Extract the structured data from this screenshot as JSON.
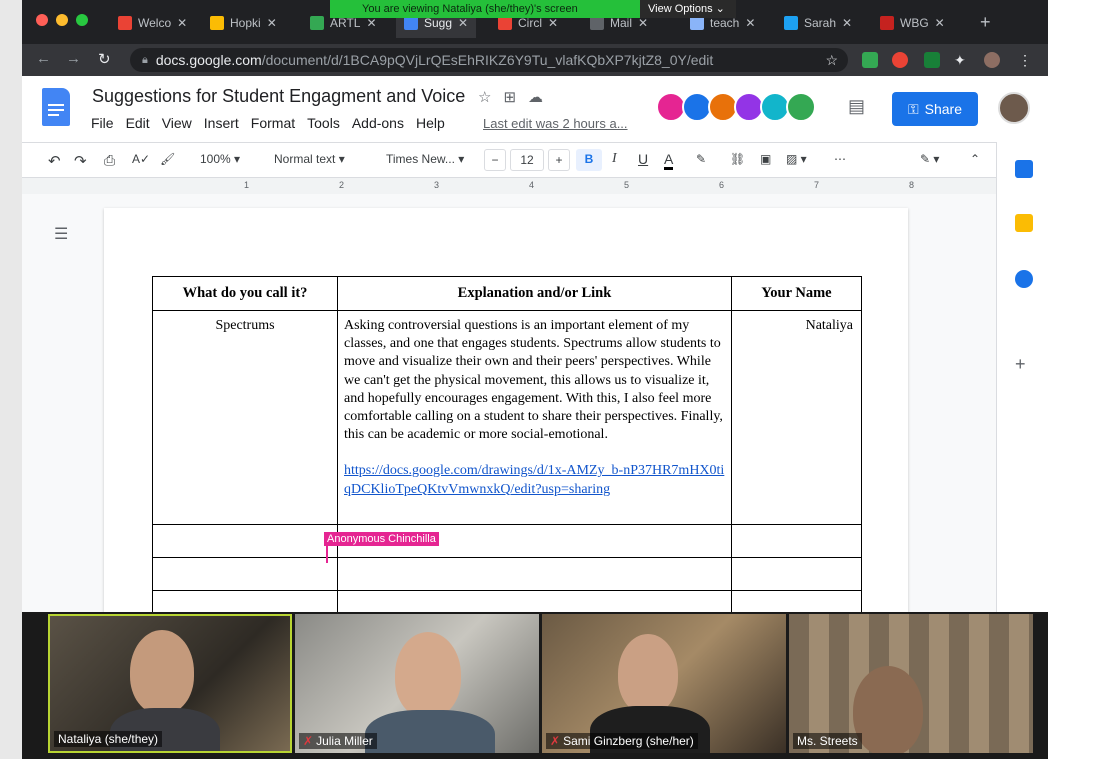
{
  "zoom": {
    "banner": "You are viewing Nataliya (she/they)'s screen",
    "view_options": "View Options ⌄"
  },
  "browser": {
    "tabs": [
      {
        "label": "Welco",
        "color": "#ea4335"
      },
      {
        "label": "Hopki",
        "color": "#fbbc04"
      },
      {
        "label": "ARTL",
        "color": "#34a853"
      },
      {
        "label": "Sugg",
        "color": "#4285f4"
      },
      {
        "label": "Circl",
        "color": "#ea4335"
      },
      {
        "label": "Mail",
        "color": "#5f6368"
      },
      {
        "label": "teach",
        "color": "#8ab4f8"
      },
      {
        "label": "Sarah",
        "color": "#1da1f2"
      },
      {
        "label": "WBG",
        "color": "#c5221f"
      }
    ],
    "url_host": "docs.google.com",
    "url_path": "/document/d/1BCA9pQVjLrQEsEhRIKZ6Y9Tu_vlafKQbXP7kjtZ8_0Y/edit"
  },
  "docs": {
    "title": "Suggestions for Student Engagment and Voice",
    "menu": [
      "File",
      "Edit",
      "View",
      "Insert",
      "Format",
      "Tools",
      "Add-ons",
      "Help"
    ],
    "last_edit": "Last edit was 2 hours a...",
    "share": "Share",
    "toolbar": {
      "zoom": "100%",
      "style": "Normal text",
      "font": "Times New...",
      "size": "12",
      "minus": "−",
      "plus": "+"
    },
    "ruler": [
      "1",
      "2",
      "3",
      "4",
      "5",
      "6",
      "7",
      "8"
    ],
    "collaborator_colors": [
      "#e52592",
      "#1a73e8",
      "#e8710a",
      "#9334e6",
      "#12b5cb",
      "#34a853"
    ]
  },
  "table": {
    "headers": [
      "What do you call it?",
      "Explanation and/or Link",
      "Your Name"
    ],
    "row1": {
      "name": "Spectrums",
      "explanation": "Asking controversial questions is an important element of my classes, and one that engages students. Spectrums allow students to move and visualize their own and their peers' perspectives. While we can't get the physical movement, this allows us to visualize it, and hopefully encourages engagement. With this, I also feel more comfortable calling on a student to share their perspectives. Finally, this can be academic or more social-emotional.",
      "link": "https://docs.google.com/drawings/d/1x-AMZy_b-nP37HR7mHX0tiqDCKlioTpeQKtvVmwnxkQ/edit?usp=sharing",
      "author": "Nataliya"
    },
    "cursor_label": "Anonymous Chinchilla"
  },
  "participants": [
    {
      "name": "Nataliya (she/they)",
      "muted": false
    },
    {
      "name": "Julia Miller",
      "muted": true
    },
    {
      "name": "Sami Ginzberg (she/her)",
      "muted": true
    },
    {
      "name": "Ms. Streets",
      "muted": false
    }
  ]
}
